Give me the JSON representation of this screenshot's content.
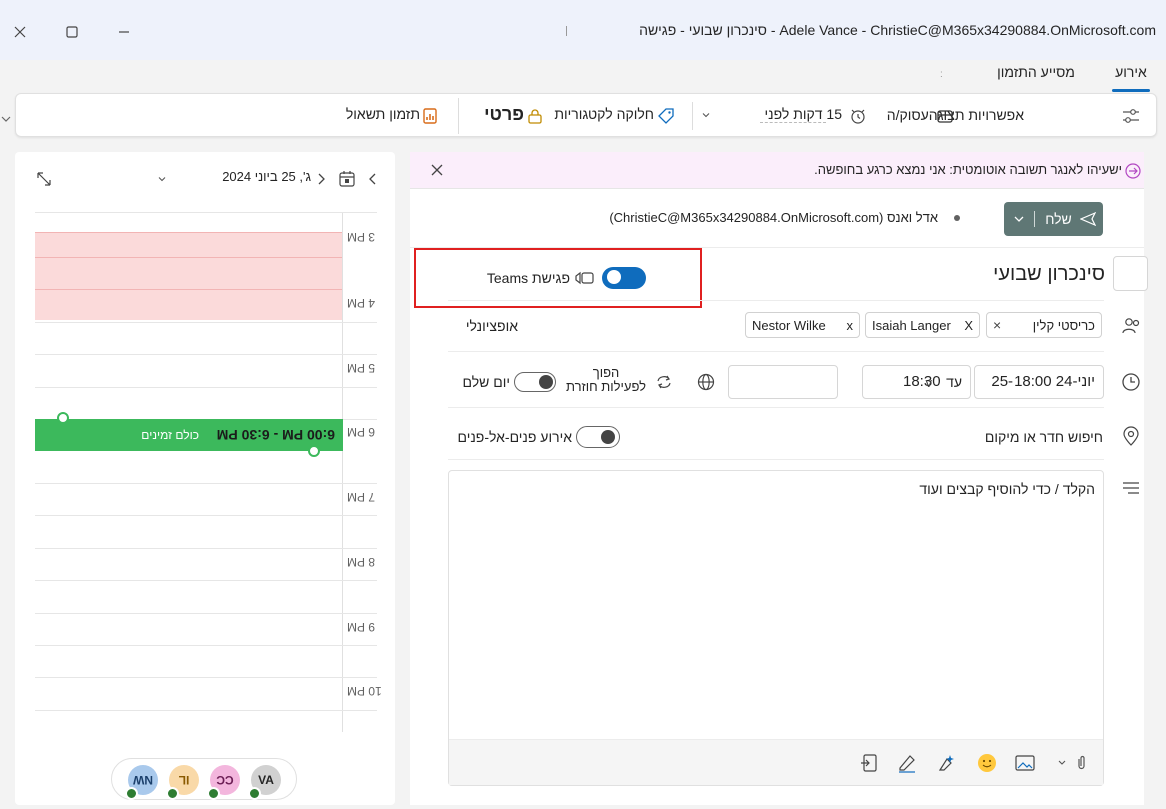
{
  "window": {
    "title": "Adele Vance - ChristieC@M365x34290884.OnMicrosoft.com - סינכרון שבועי - פגישה"
  },
  "tabs": [
    {
      "label": "אירוע",
      "active": true
    },
    {
      "label": "מסייע התזמון",
      "active": false
    }
  ],
  "ribbon": {
    "busy_label": "אפשרויות תצוגהעסוק/ה",
    "reminder_label": "15 דקות לפני",
    "categorize_label": "חלוקה לקטגוריות",
    "private_label": "פרטי",
    "poll_label": "תזמון תשאול"
  },
  "calendar": {
    "date_label": "ג', 25 ביוני 2024",
    "hours": [
      "3 PM",
      "4 PM",
      "5 PM",
      "6 PM",
      "7 PM",
      "8 PM",
      "9 PM",
      "10 PM"
    ],
    "event": {
      "time": "6:00 PM - 6:30 PM",
      "status": "כולם זמינים"
    },
    "attendees": [
      {
        "initials": "VA",
        "color": "#d1d1d1",
        "text_color": "#242424"
      },
      {
        "initials": "CC",
        "color": "#f3b6dd",
        "text_color": "#6b1d54"
      },
      {
        "initials": "IL",
        "color": "#f9d9a8",
        "text_color": "#8a5a00"
      },
      {
        "initials": "NW",
        "color": "#a9c9ec",
        "text_color": "#1b3f6b"
      }
    ]
  },
  "form": {
    "auto_reply": "ישעיהו לאנגר תשובה אוטומטית: אני נמצא כרגע בחופשה.",
    "send_label": "שלח",
    "from_name": "אדל ואנס",
    "from_email": "(ChristieC@M365x34290884.OnMicrosoft.com)",
    "title": "סינכרון שבועי",
    "teams_label": "פגישת Teams",
    "attendees": [
      "כריסטי קלין",
      "Isaiah Langer",
      "Nestor Wilke"
    ],
    "optional_label": "אופציונלי",
    "date_value": "25-יוני-24",
    "start_time": "18:00",
    "end_label": "עד",
    "end_time": "18:30",
    "recurring_line1": "הפוך",
    "recurring_line2": "לפעילות חוזרת",
    "all_day_label": "יום שלם",
    "location_placeholder": "חיפוש חדר או מיקום",
    "in_person_label": "אירוע פנים-אל-פנים",
    "body_placeholder": "הקלד / כדי להוסיף קבצים ועוד"
  },
  "colors": {
    "accent": "#0f6cbd",
    "event_green": "#3cb95c",
    "busy_pink": "#fbdada",
    "banner_bg": "#fbeefb",
    "highlight_red": "#e02020",
    "send_gray": "#5f7775"
  }
}
